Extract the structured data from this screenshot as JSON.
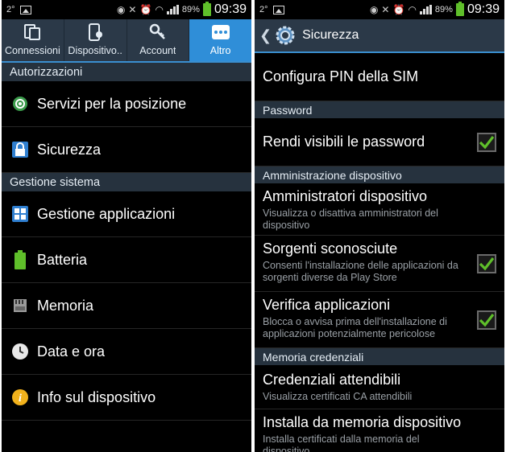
{
  "left": {
    "status": {
      "temp": "2°",
      "battery": "89%",
      "time": "09:39"
    },
    "tabs": [
      {
        "label": "Connessioni",
        "icon": "connections-icon"
      },
      {
        "label": "Dispositivo..",
        "icon": "device-icon"
      },
      {
        "label": "Account",
        "icon": "key-icon"
      },
      {
        "label": "Altro",
        "icon": "more-dots-icon",
        "active": true
      }
    ],
    "sections": {
      "autorizzazioni": "Autorizzazioni",
      "gestione": "Gestione sistema"
    },
    "items": [
      {
        "label": "Servizi per la posizione",
        "icon": "location-icon"
      },
      {
        "label": "Sicurezza",
        "icon": "lock-icon"
      },
      {
        "label": "Gestione applicazioni",
        "icon": "apps-grid-icon"
      },
      {
        "label": "Batteria",
        "icon": "battery-icon"
      },
      {
        "label": "Memoria",
        "icon": "memory-card-icon"
      },
      {
        "label": "Data e ora",
        "icon": "clock-icon"
      },
      {
        "label": "Info sul dispositivo",
        "icon": "info-icon"
      }
    ]
  },
  "right": {
    "status": {
      "temp": "2°",
      "battery": "89%",
      "time": "09:39"
    },
    "title": "Sicurezza",
    "items": {
      "pin": {
        "title": "Configura PIN della SIM"
      },
      "password_section": "Password",
      "visible_pw": {
        "title": "Rendi visibili le password",
        "checked": true
      },
      "admin_section": "Amministrazione dispositivo",
      "admins": {
        "title": "Amministratori dispositivo",
        "subtitle": "Visualizza o disattiva amministratori del dispositivo"
      },
      "unknown_sources": {
        "title": "Sorgenti sconosciute",
        "subtitle": "Consenti l'installazione delle applicazioni da sorgenti diverse da Play Store",
        "checked": true
      },
      "verify_apps": {
        "title": "Verifica applicazioni",
        "subtitle": "Blocca o avvisa prima dell'installazione di applicazioni potenzialmente pericolose",
        "checked": true
      },
      "cred_section": "Memoria credenziali",
      "trusted_creds": {
        "title": "Credenziali attendibili",
        "subtitle": "Visualizza certificati CA attendibili"
      },
      "install_storage": {
        "title": "Installa da memoria dispositivo",
        "subtitle": "Installa certificati dalla memoria del dispositivo"
      }
    }
  },
  "colors": {
    "accent": "#2f8ed8",
    "header": "#2b3948",
    "check": "#5fbf2a"
  }
}
